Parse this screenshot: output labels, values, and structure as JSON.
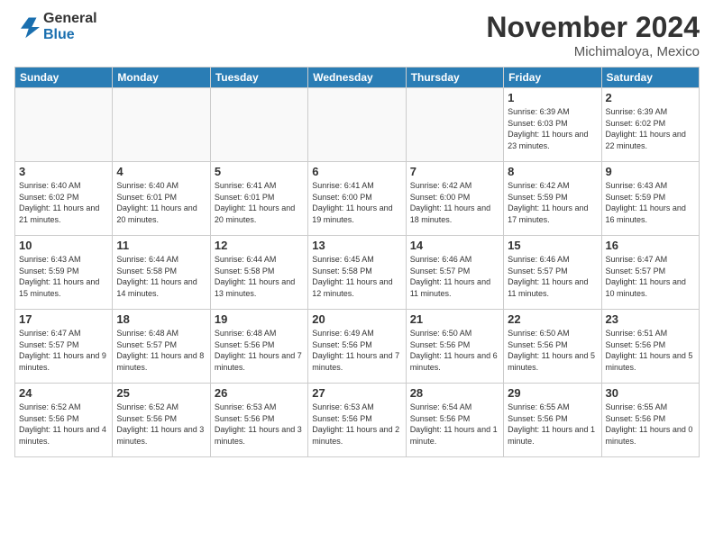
{
  "header": {
    "logo_general": "General",
    "logo_blue": "Blue",
    "month_title": "November 2024",
    "subtitle": "Michimaloya, Mexico"
  },
  "days_of_week": [
    "Sunday",
    "Monday",
    "Tuesday",
    "Wednesday",
    "Thursday",
    "Friday",
    "Saturday"
  ],
  "weeks": [
    [
      {
        "day": "",
        "info": ""
      },
      {
        "day": "",
        "info": ""
      },
      {
        "day": "",
        "info": ""
      },
      {
        "day": "",
        "info": ""
      },
      {
        "day": "",
        "info": ""
      },
      {
        "day": "1",
        "info": "Sunrise: 6:39 AM\nSunset: 6:03 PM\nDaylight: 11 hours and 23 minutes."
      },
      {
        "day": "2",
        "info": "Sunrise: 6:39 AM\nSunset: 6:02 PM\nDaylight: 11 hours and 22 minutes."
      }
    ],
    [
      {
        "day": "3",
        "info": "Sunrise: 6:40 AM\nSunset: 6:02 PM\nDaylight: 11 hours and 21 minutes."
      },
      {
        "day": "4",
        "info": "Sunrise: 6:40 AM\nSunset: 6:01 PM\nDaylight: 11 hours and 20 minutes."
      },
      {
        "day": "5",
        "info": "Sunrise: 6:41 AM\nSunset: 6:01 PM\nDaylight: 11 hours and 20 minutes."
      },
      {
        "day": "6",
        "info": "Sunrise: 6:41 AM\nSunset: 6:00 PM\nDaylight: 11 hours and 19 minutes."
      },
      {
        "day": "7",
        "info": "Sunrise: 6:42 AM\nSunset: 6:00 PM\nDaylight: 11 hours and 18 minutes."
      },
      {
        "day": "8",
        "info": "Sunrise: 6:42 AM\nSunset: 5:59 PM\nDaylight: 11 hours and 17 minutes."
      },
      {
        "day": "9",
        "info": "Sunrise: 6:43 AM\nSunset: 5:59 PM\nDaylight: 11 hours and 16 minutes."
      }
    ],
    [
      {
        "day": "10",
        "info": "Sunrise: 6:43 AM\nSunset: 5:59 PM\nDaylight: 11 hours and 15 minutes."
      },
      {
        "day": "11",
        "info": "Sunrise: 6:44 AM\nSunset: 5:58 PM\nDaylight: 11 hours and 14 minutes."
      },
      {
        "day": "12",
        "info": "Sunrise: 6:44 AM\nSunset: 5:58 PM\nDaylight: 11 hours and 13 minutes."
      },
      {
        "day": "13",
        "info": "Sunrise: 6:45 AM\nSunset: 5:58 PM\nDaylight: 11 hours and 12 minutes."
      },
      {
        "day": "14",
        "info": "Sunrise: 6:46 AM\nSunset: 5:57 PM\nDaylight: 11 hours and 11 minutes."
      },
      {
        "day": "15",
        "info": "Sunrise: 6:46 AM\nSunset: 5:57 PM\nDaylight: 11 hours and 11 minutes."
      },
      {
        "day": "16",
        "info": "Sunrise: 6:47 AM\nSunset: 5:57 PM\nDaylight: 11 hours and 10 minutes."
      }
    ],
    [
      {
        "day": "17",
        "info": "Sunrise: 6:47 AM\nSunset: 5:57 PM\nDaylight: 11 hours and 9 minutes."
      },
      {
        "day": "18",
        "info": "Sunrise: 6:48 AM\nSunset: 5:57 PM\nDaylight: 11 hours and 8 minutes."
      },
      {
        "day": "19",
        "info": "Sunrise: 6:48 AM\nSunset: 5:56 PM\nDaylight: 11 hours and 7 minutes."
      },
      {
        "day": "20",
        "info": "Sunrise: 6:49 AM\nSunset: 5:56 PM\nDaylight: 11 hours and 7 minutes."
      },
      {
        "day": "21",
        "info": "Sunrise: 6:50 AM\nSunset: 5:56 PM\nDaylight: 11 hours and 6 minutes."
      },
      {
        "day": "22",
        "info": "Sunrise: 6:50 AM\nSunset: 5:56 PM\nDaylight: 11 hours and 5 minutes."
      },
      {
        "day": "23",
        "info": "Sunrise: 6:51 AM\nSunset: 5:56 PM\nDaylight: 11 hours and 5 minutes."
      }
    ],
    [
      {
        "day": "24",
        "info": "Sunrise: 6:52 AM\nSunset: 5:56 PM\nDaylight: 11 hours and 4 minutes."
      },
      {
        "day": "25",
        "info": "Sunrise: 6:52 AM\nSunset: 5:56 PM\nDaylight: 11 hours and 3 minutes."
      },
      {
        "day": "26",
        "info": "Sunrise: 6:53 AM\nSunset: 5:56 PM\nDaylight: 11 hours and 3 minutes."
      },
      {
        "day": "27",
        "info": "Sunrise: 6:53 AM\nSunset: 5:56 PM\nDaylight: 11 hours and 2 minutes."
      },
      {
        "day": "28",
        "info": "Sunrise: 6:54 AM\nSunset: 5:56 PM\nDaylight: 11 hours and 1 minute."
      },
      {
        "day": "29",
        "info": "Sunrise: 6:55 AM\nSunset: 5:56 PM\nDaylight: 11 hours and 1 minute."
      },
      {
        "day": "30",
        "info": "Sunrise: 6:55 AM\nSunset: 5:56 PM\nDaylight: 11 hours and 0 minutes."
      }
    ]
  ]
}
